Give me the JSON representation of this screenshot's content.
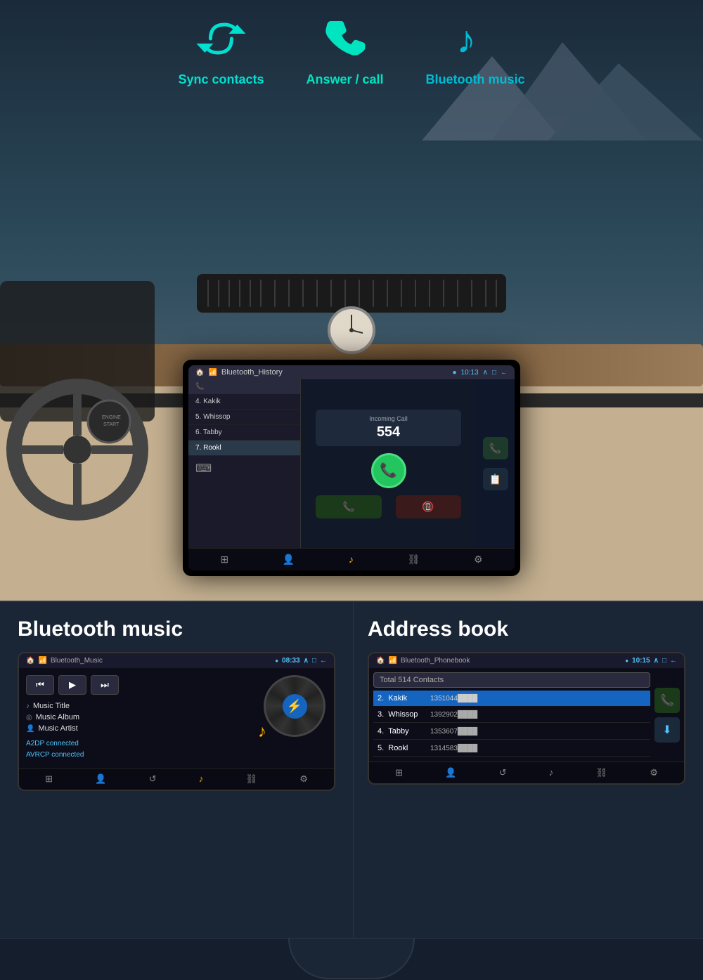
{
  "features": [
    {
      "id": "sync-contacts",
      "icon": "sync",
      "label": "Sync contacts",
      "color": "#00e0d0"
    },
    {
      "id": "answer-call",
      "icon": "phone",
      "label": "Answer / call",
      "color": "#00e5c0"
    },
    {
      "id": "bluetooth-music",
      "icon": "music",
      "label": "Bluetooth music",
      "color": "#00bcd4"
    }
  ],
  "car_screen": {
    "title": "Bluetooth_History",
    "time": "10:13",
    "contacts": [
      {
        "number": "4.",
        "name": "Kakik"
      },
      {
        "number": "5.",
        "name": "Whissop"
      },
      {
        "number": "6.",
        "name": "Tabby"
      },
      {
        "number": "7.",
        "name": "Rookl"
      }
    ],
    "incoming_call": {
      "label": "Incoming Call",
      "number": "554"
    }
  },
  "bluetooth_music_panel": {
    "title": "Bluetooth music",
    "screen_title": "Bluetooth_Music",
    "time": "08:33",
    "track": {
      "title": "Music Title",
      "album": "Music Album",
      "artist": "Music Artist"
    },
    "status": {
      "a2dp": "A2DP connected",
      "avrcp": "AVRCP connected"
    },
    "controls": {
      "prev": "⏮",
      "play": "▶",
      "next": "⏭"
    }
  },
  "address_book_panel": {
    "title": "Address book",
    "screen_title": "Bluetooth_Phonebook",
    "time": "10:15",
    "total_contacts": "Total 514 Contacts",
    "contacts": [
      {
        "number": "2.",
        "name": "Kakik",
        "phone": "1351044████"
      },
      {
        "number": "3.",
        "name": "Whissop",
        "phone": "1392902████"
      },
      {
        "number": "4.",
        "name": "Tabby",
        "phone": "1353607████"
      },
      {
        "number": "5.",
        "name": "Rookl",
        "phone": "1314583████"
      }
    ]
  },
  "nav_icons": {
    "apps": "⊞",
    "contacts": "👤",
    "refresh": "↺",
    "music": "♪",
    "link": "⛓",
    "settings": "⚙"
  }
}
